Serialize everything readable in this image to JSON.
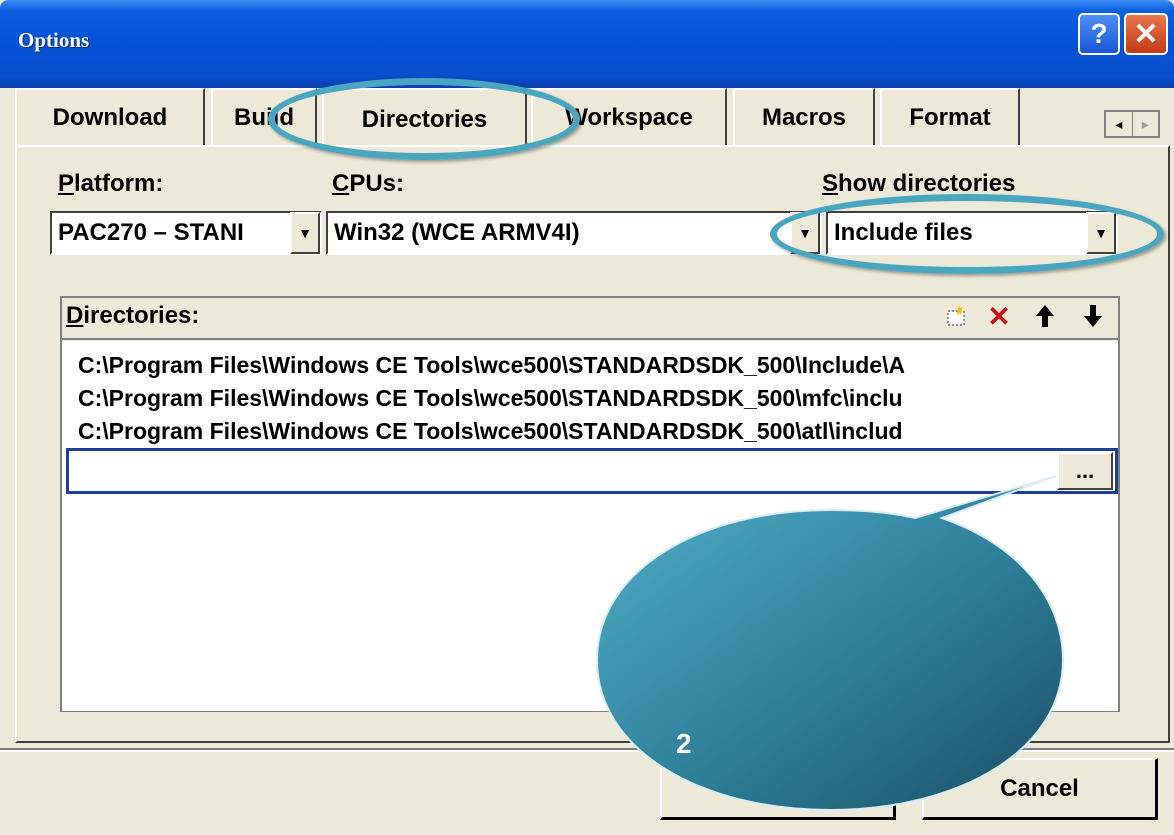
{
  "window": {
    "title": "Options",
    "help_label": "?",
    "close_label": "✕"
  },
  "tabs": [
    {
      "label": "Download"
    },
    {
      "label": "Build"
    },
    {
      "label": "Directories"
    },
    {
      "label": "Workspace"
    },
    {
      "label": "Macros"
    },
    {
      "label": "Format"
    }
  ],
  "tab_scroll": {
    "left": "◂",
    "right": "▸"
  },
  "platform": {
    "label_first": "P",
    "label_rest": "latform:",
    "value": "PAC270 – STANI"
  },
  "cpus": {
    "label_first": "C",
    "label_rest": "PUs:",
    "value": "Win32 (WCE ARMV4I)"
  },
  "show_dirs": {
    "label_first": "S",
    "label_rest": "how directories",
    "value": "Include files"
  },
  "directories": {
    "label_first": "D",
    "label_rest": "irectories:",
    "items": [
      "C:\\Program Files\\Windows CE Tools\\wce500\\STANDARDSDK_500\\Include\\A",
      "C:\\Program Files\\Windows CE Tools\\wce500\\STANDARDSDK_500\\mfc\\inclu",
      "C:\\Program Files\\Windows CE Tools\\wce500\\STANDARDSDK_500\\atl\\includ"
    ],
    "edit_value": "",
    "browse_label": "..."
  },
  "toolbar_icons": [
    "new-folder-icon",
    "delete-icon",
    "move-up-icon",
    "move-down-icon"
  ],
  "buttons": {
    "ok_label": "",
    "cancel_label": "Cancel"
  },
  "callout": {
    "label": "2"
  },
  "colors": {
    "titlebar": "#0553d6",
    "highlight_ring": "#4aa6c0",
    "callout": "#2f7f99"
  }
}
